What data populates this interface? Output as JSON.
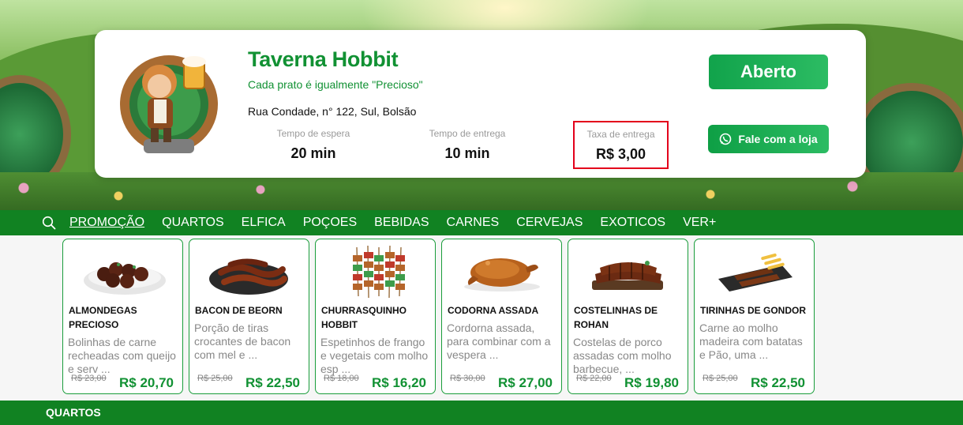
{
  "store": {
    "name": "Taverna Hobbit",
    "tagline": "Cada prato é igualmente \"Precioso\"",
    "address": "Rua Condade, n° 122, Sul, Bolsão",
    "status": "Aberto",
    "contact_label": "Fale com a loja"
  },
  "stats": {
    "wait_label": "Tempo de espera",
    "wait_value": "20 min",
    "delivery_label": "Tempo de entrega",
    "delivery_value": "10 min",
    "fee_label": "Taxa de entrega",
    "fee_value": "R$ 3,00"
  },
  "nav": {
    "items": [
      "PROMOÇÃO",
      "QUARTOS",
      "ELFICA",
      "POÇOES",
      "BEBIDAS",
      "CARNES",
      "CERVEJAS",
      "EXOTICOS",
      "VER+"
    ]
  },
  "products": [
    {
      "name": "ALMONDEGAS PRECIOSO",
      "desc": "Bolinhas de carne recheadas com queijo e serv ...",
      "old_price": "R$ 23,00",
      "price": "R$ 20,70",
      "icon": "meatballs-icon"
    },
    {
      "name": "BACON DE BEORN",
      "desc": "Porção de tiras crocantes de bacon com mel e ...",
      "old_price": "R$ 25,00",
      "price": "R$ 22,50",
      "icon": "bacon-icon"
    },
    {
      "name": "CHURRASQUINHO HOBBIT",
      "desc": "Espetinhos de frango e vegetais com molho esp ...",
      "old_price": "R$ 18,00",
      "price": "R$ 16,20",
      "icon": "skewers-icon"
    },
    {
      "name": "CODORNA ASSADA",
      "desc": "Cordorna assada, para combinar com a vespera ...",
      "old_price": "R$ 30,00",
      "price": "R$ 27,00",
      "icon": "roast-quail-icon"
    },
    {
      "name": "COSTELINHAS DE ROHAN",
      "desc": "Costelas de porco assadas com molho barbecue, ...",
      "old_price": "R$ 22,00",
      "price": "R$ 19,80",
      "icon": "ribs-icon"
    },
    {
      "name": "TIRINHAS DE GONDOR",
      "desc": "Carne ao molho madeira com batatas e Pão, uma ...",
      "old_price": "R$ 25,00",
      "price": "R$ 22,50",
      "icon": "beef-strips-icon"
    }
  ],
  "section": {
    "title": "QUARTOS"
  },
  "colors": {
    "brand_green": "#119133",
    "nav_green": "#118222",
    "highlight_red": "#e3001b"
  }
}
